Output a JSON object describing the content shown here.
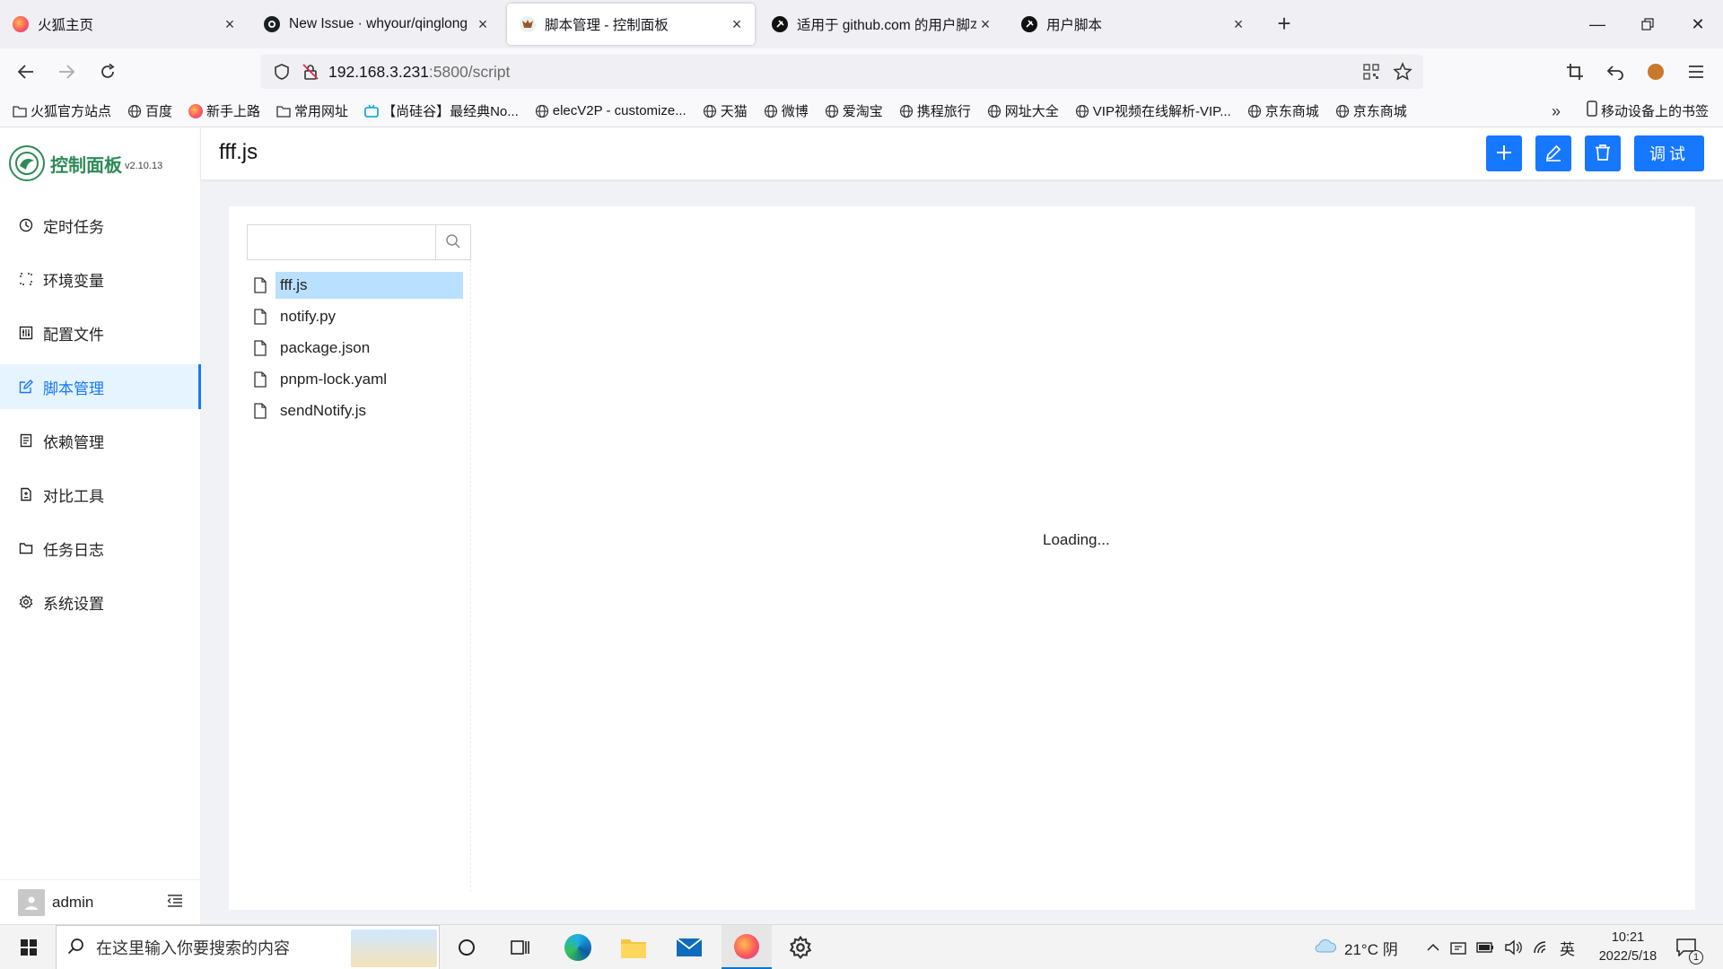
{
  "browser": {
    "tabs": [
      {
        "label": "火狐主页",
        "icon": "firefox-icon"
      },
      {
        "label": "New Issue · whyour/qinglong",
        "icon": "github-icon"
      },
      {
        "label": "脚本管理 - 控制面板",
        "icon": "qinglong-icon"
      },
      {
        "label": "适用于 github.com 的用户脚本",
        "icon": "greasyfork-icon"
      },
      {
        "label": "用户脚本",
        "icon": "greasyfork-icon"
      }
    ],
    "url_host": "192.168.3.231",
    "url_rest": ":5800/script",
    "bookmarks": [
      {
        "label": "火狐官方站点",
        "icon": "folder-icon"
      },
      {
        "label": "百度",
        "icon": "globe-icon"
      },
      {
        "label": "新手上路",
        "icon": "firefox-icon"
      },
      {
        "label": "常用网址",
        "icon": "folder-icon"
      },
      {
        "label": "【尚硅谷】最经典No...",
        "icon": "bilibili-icon"
      },
      {
        "label": "elecV2P - customize...",
        "icon": "globe-icon"
      },
      {
        "label": "天猫",
        "icon": "globe-icon"
      },
      {
        "label": "微博",
        "icon": "globe-icon"
      },
      {
        "label": "爱淘宝",
        "icon": "globe-icon"
      },
      {
        "label": "携程旅行",
        "icon": "globe-icon"
      },
      {
        "label": "网址大全",
        "icon": "globe-icon"
      },
      {
        "label": "VIP视频在线解析-VIP...",
        "icon": "globe-icon"
      },
      {
        "label": "京东商城",
        "icon": "globe-icon"
      },
      {
        "label": "京东商城",
        "icon": "globe-icon"
      }
    ],
    "mobile_bookmarks": "移动设备上的书签"
  },
  "app": {
    "name": "控制面板",
    "version": "v2.10.13",
    "menu": [
      {
        "label": "定时任务",
        "icon": "clock-icon"
      },
      {
        "label": "环境变量",
        "icon": "variable-icon"
      },
      {
        "label": "配置文件",
        "icon": "control-icon"
      },
      {
        "label": "脚本管理",
        "icon": "edit-icon"
      },
      {
        "label": "依赖管理",
        "icon": "container-icon"
      },
      {
        "label": "对比工具",
        "icon": "diff-icon"
      },
      {
        "label": "任务日志",
        "icon": "folder-icon"
      },
      {
        "label": "系统设置",
        "icon": "setting-icon"
      }
    ],
    "active_menu": "脚本管理",
    "user": "admin",
    "page_title": "fff.js",
    "debug_label": "调试",
    "search_placeholder": "",
    "files": [
      "fff.js",
      "notify.py",
      "package.json",
      "pnpm-lock.yaml",
      "sendNotify.js"
    ],
    "selected_file": "fff.js",
    "loading_text": "Loading..."
  },
  "taskbar": {
    "search_placeholder": "在这里输入你要搜索的内容",
    "weather": "21°C 阴",
    "ime": "英",
    "time": "10:21",
    "date": "2022/5/18",
    "notification_count": "1"
  },
  "colors": {
    "primary": "#1677ff",
    "active_menu_bg": "#e6f4ff",
    "selected_file_bg": "#bae0ff",
    "brand_green": "#2e8b57"
  }
}
